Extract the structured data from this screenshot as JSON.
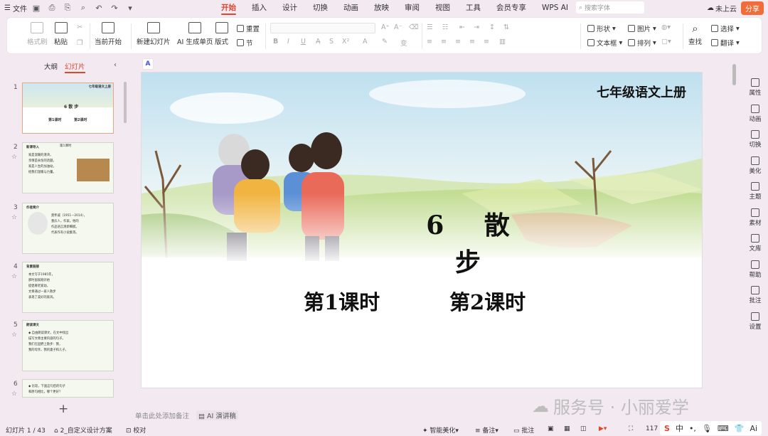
{
  "titlebar": {
    "file_menu": "文件",
    "tabs": [
      "开始",
      "插入",
      "设计",
      "切换",
      "动画",
      "放映",
      "审阅",
      "视图",
      "工具",
      "会员专享",
      "WPS AI"
    ],
    "active_tab": "开始",
    "search_placeholder": "搜索字体",
    "cloud_label": "未上云",
    "share_label": "分享"
  },
  "ribbon": {
    "format_painter": "格式刷",
    "paste": "粘贴",
    "start_from_current": "当前开始",
    "new_slide": "新建幻灯片",
    "ai_generate": "AI 生成单页",
    "layout": "版式",
    "reset": "重置",
    "section": "节",
    "shape": "形状",
    "picture": "图片",
    "textbox": "文本框",
    "arrange": "排列",
    "find": "查找",
    "select": "选择",
    "translate": "翻译"
  },
  "sidepanel": {
    "tab_outline": "大纲",
    "tab_slides": "幻灯片",
    "slides": [
      {
        "num": "1",
        "title": "6 散 步",
        "sub1": "第1课时",
        "sub2": "第2课时",
        "tag": "七年级语文上册"
      },
      {
        "num": "2",
        "heading": "新课导入",
        "tag": "第1课时",
        "lines": [
          "家是温暖的港湾，",
          "亲情是永恒的话题。",
          "家是人生的加油站，",
          "给我们温暖与力量。"
        ]
      },
      {
        "num": "3",
        "heading": "作者简介",
        "lines": [
          "莫怀戚（1951—2014），",
          "重庆人，作家。他的",
          "作品语言清新细腻。",
          "代表作有小说集等。"
        ]
      },
      {
        "num": "4",
        "heading": "背景链接",
        "lines": [
          "本文写于1985年，",
          "那时国家刚开始",
          "提倡尊老爱幼，",
          "文章通过一家人散步",
          "表现了美好的家风。"
        ]
      },
      {
        "num": "5",
        "heading": "朗读课文",
        "lines": [
          "◆ 自由朗读课文，在文中找出",
          "描写文章主要内容的句子。",
          "我们在田野上散步：我，",
          "我的母亲，我的妻子和儿子。"
        ]
      },
      {
        "num": "6",
        "heading": "",
        "lines": [
          "◆ 比较，下面这句后的句子",
          "和原句相比，哪个更好？"
        ]
      }
    ]
  },
  "slide": {
    "tag": "七年级语文上册",
    "title": "6 散 步",
    "lesson1": "第1课时",
    "lesson2": "第2课时"
  },
  "rightbar": [
    "属性",
    "动画",
    "切换",
    "美化",
    "主题",
    "素材",
    "文库",
    "帮助",
    "批注",
    "设置"
  ],
  "notes": {
    "placeholder": "单击此处添加备注",
    "ai_speech": "AI 演讲稿"
  },
  "statusbar": {
    "slide_count": "幻灯片 1 / 43",
    "theme": "2_自定义设计方案",
    "proofread": "校对",
    "smart_beautify": "智能美化",
    "notes": "备注",
    "comments": "批注",
    "zoom": "117"
  },
  "watermark": "服务号 · 小丽爱学",
  "ime": {
    "lang": "中"
  },
  "colors": {
    "accent": "#e0462e",
    "share": "#f26c3a",
    "sky": "#cfe6f2",
    "field": "#b9d68a"
  }
}
